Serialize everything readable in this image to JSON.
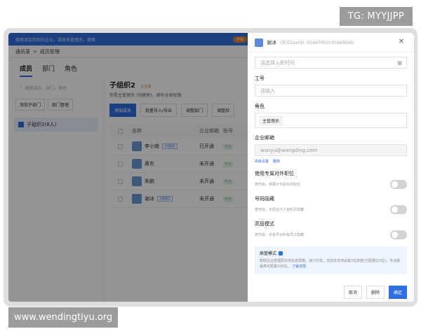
{
  "tag_badge": "TG: MYYJJPP",
  "site_badge": "www.wendingtiyu.org",
  "background_app": {
    "topbar_text": "搜索添加到你的企业，或联系管理员，搜索",
    "topbar_pill": "升级",
    "breadcrumb": [
      "通讯录",
      ">",
      "成员管理"
    ],
    "tabs": [
      "成员",
      "部门",
      "角色"
    ],
    "search_placeholder": "搜索成员、部门、角色",
    "left_buttons": [
      "添加子部门",
      "部门管理"
    ],
    "group_label": "子组织2(8人)",
    "main_title": "子组织2",
    "main_title_badge": "企业版",
    "main_sub": "你是主管理员 (创建者)，拥有全部权限",
    "actions": [
      "添加成员",
      "批量导入/导出",
      "调整部门",
      "调整权"
    ],
    "table_headers": [
      "名称",
      "企业邮箱",
      "账号"
    ],
    "rows": [
      {
        "name": "李小南",
        "role": "主管理员",
        "status": "已开通",
        "tag": "个人"
      },
      {
        "name": "黄东",
        "role": "",
        "status": "未开通",
        "tag": "个人"
      },
      {
        "name": "朱鹏",
        "role": "",
        "status": "未开通",
        "tag": "个人"
      },
      {
        "name": "谢冰",
        "role": "主管理员",
        "status": "未开通",
        "tag": "个人"
      }
    ]
  },
  "drawer": {
    "user_name": "谢冰",
    "user_id": "(员工UserID: 01447002030960996)",
    "join_date_placeholder": "请选择入职时间",
    "job_no_label": "工号",
    "job_no_placeholder": "请输入",
    "role_label": "角色",
    "role_value": "主管理员",
    "email_label": "企业邮箱",
    "email_value": "wanyu@wangding.com",
    "email_links": [
      "高级设置",
      "删除"
    ],
    "external_label": "使用专属对外职位",
    "external_desc": "若开启，将展示专属对外职位",
    "hide_label": "号码隐藏",
    "hide_desc": "若开启，手机在个人资料页隐藏",
    "exec_label": "高管模式",
    "exec_desc": "若开启，手机号对所有员工隐藏",
    "info_title": "高管模式",
    "info_desc": "帮助企业管理层实现信息屏蔽，减少打扰，当前仅支持设置3位高管(已配置0/3位)，专业版最高可配置100位。",
    "info_link": "了解详情",
    "footer": {
      "cancel": "取消",
      "delete": "删除",
      "confirm": "确定"
    },
    "toggles": {
      "external": false,
      "hide": false,
      "exec": false
    }
  }
}
